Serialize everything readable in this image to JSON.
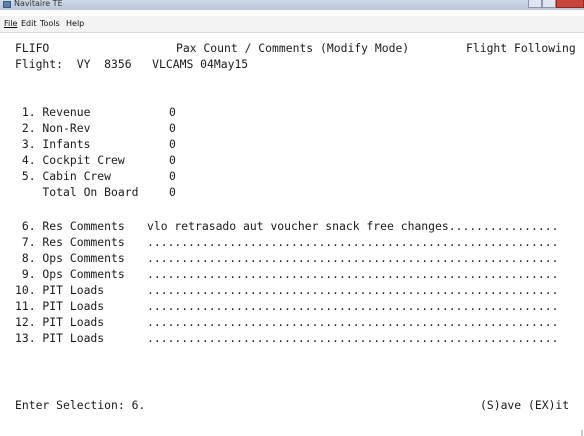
{
  "window": {
    "title": "Navitaire TE"
  },
  "menu": {
    "file": "File",
    "edit": "Edit",
    "tools": "Tools",
    "help": "Help"
  },
  "header": {
    "screen_code": "FLIFO",
    "title": "Pax Count / Comments (Modify Mode)",
    "mode": "Flight Following",
    "flight_line": "Flight:  VY  8356   VLCAMS 04May15"
  },
  "counts": [
    {
      "label": " 1. Revenue",
      "value": "0"
    },
    {
      "label": " 2. Non-Rev",
      "value": "0"
    },
    {
      "label": " 3. Infants",
      "value": "0"
    },
    {
      "label": " 4. Cockpit Crew",
      "value": "0"
    },
    {
      "label": " 5. Cabin Crew",
      "value": "0"
    },
    {
      "label": "    Total On Board",
      "value": "0"
    }
  ],
  "comments": [
    {
      "label": " 6. Res Comments",
      "value": "vlo retrasado aut voucher snack free changes................"
    },
    {
      "label": " 7. Res Comments",
      "value": "............................................................"
    },
    {
      "label": " 8. Ops Comments",
      "value": "............................................................"
    },
    {
      "label": " 9. Ops Comments",
      "value": "............................................................"
    },
    {
      "label": "10. PIT Loads",
      "value": "............................................................"
    },
    {
      "label": "11. PIT Loads",
      "value": "............................................................"
    },
    {
      "label": "12. PIT Loads",
      "value": "............................................................"
    },
    {
      "label": "13. PIT Loads",
      "value": "............................................................"
    }
  ],
  "footer": {
    "prompt": "Enter Selection: 6.",
    "actions": "(S)ave (EX)it"
  }
}
